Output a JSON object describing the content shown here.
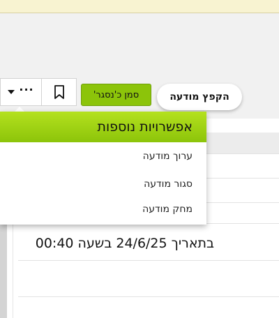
{
  "toolbar": {
    "bump_label": "הקפץ מודעה",
    "mark_closed_label": "סמן כ'נסגר'",
    "more_dots": "···"
  },
  "dropdown": {
    "title": "אפשרויות נוספות",
    "items": [
      {
        "label": "ערוך מודעה"
      },
      {
        "label": "סגור מודעה"
      },
      {
        "label": "מחק מודעה"
      }
    ]
  },
  "content": {
    "timestamp": "בתאריך 24/6/25 בשעה 00:40"
  },
  "colors": {
    "accent": "#8cc40a",
    "accent_light": "#b4e11e",
    "top_bar": "#f8f3d1"
  }
}
